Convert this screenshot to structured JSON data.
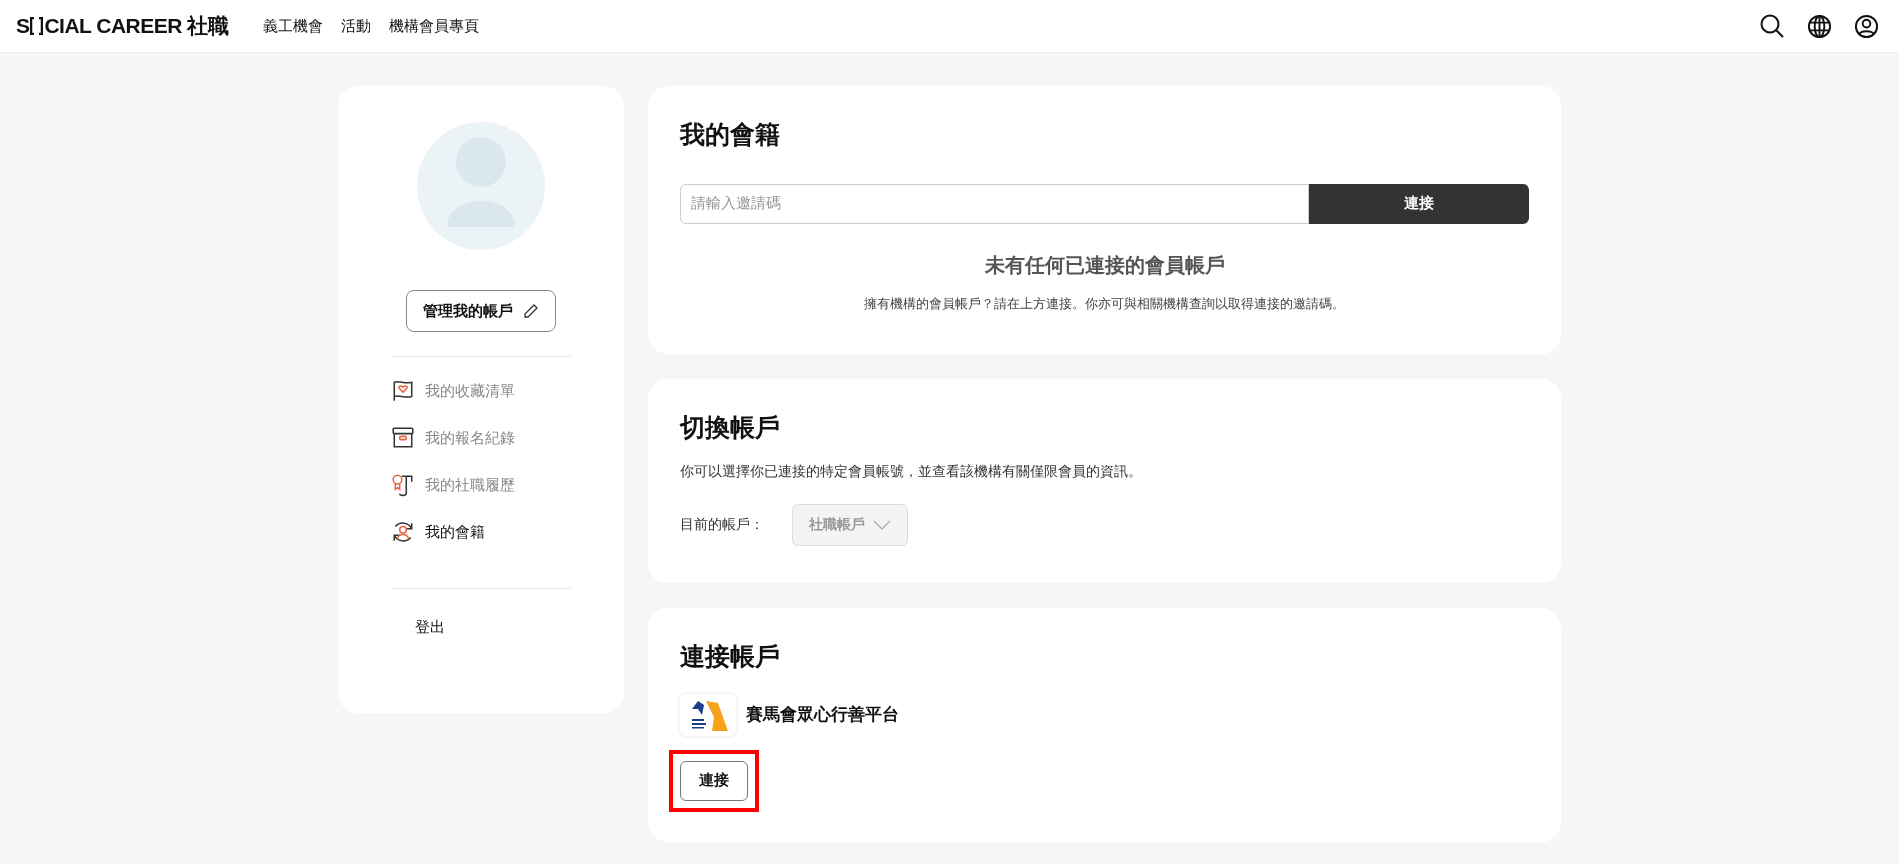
{
  "header": {
    "logo": {
      "prefix": "S",
      "rest": "CIAL CAREER 社職"
    },
    "nav": [
      "義工機會",
      "活動",
      "機構會員專頁"
    ]
  },
  "sidebar": {
    "manage_button": "管理我的帳戶",
    "items": [
      {
        "kind": "favorites",
        "label": "我的收藏清單",
        "selected": false
      },
      {
        "kind": "registrations",
        "label": "我的報名紀錄",
        "selected": false
      },
      {
        "kind": "resume",
        "label": "我的社職履歷",
        "selected": false
      },
      {
        "kind": "membership",
        "label": "我的會籍",
        "selected": true
      }
    ],
    "logout": "登出"
  },
  "membership": {
    "title": "我的會籍",
    "input": {
      "placeholder": "請輸入邀請碼"
    },
    "connect_button": "連接",
    "empty_title": "未有任何已連接的會員帳戶",
    "empty_text": "擁有機構的會員帳戶？請在上方連接。你亦可與相關機構查詢以取得連接的邀請碼。"
  },
  "switch_account": {
    "title": "切換帳戶",
    "description": "你可以選擇你已連接的特定會員帳號，並查看該機構有關僅限會員的資訊。",
    "current_label": "目前的帳戶：",
    "select": {
      "value": "社職帳戶",
      "disabled": true
    }
  },
  "connect_account": {
    "title": "連接帳戶",
    "organizations": [
      {
        "name": "賽馬會眾心行善平台",
        "button": "連接",
        "highlighted": true
      }
    ]
  }
}
